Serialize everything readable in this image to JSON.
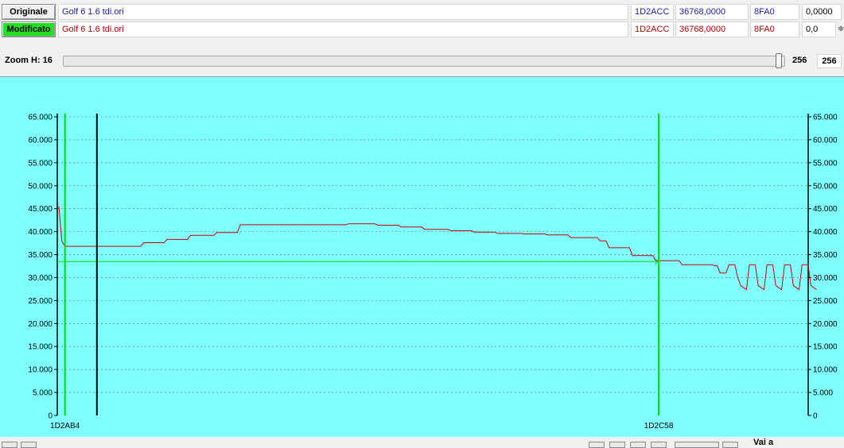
{
  "originale": {
    "button_label": "Originale",
    "filename": "Golf 6 1.6 tdi.ori",
    "address": "1D2ACC",
    "value": "36768,0000",
    "hex": "8FA0",
    "extra": "0,0000"
  },
  "modificato": {
    "button_label": "Modificato",
    "filename": "Golf 6 1.6 tdi.ori",
    "address": "1D2ACC",
    "value": "36768,0000",
    "hex": "8FA0",
    "extra": "0,0"
  },
  "zoom": {
    "label": "Zoom H: 16",
    "slider_fraction": 1.0,
    "value_label": "256",
    "box_value": "256"
  },
  "chart_data": {
    "type": "line",
    "background": "#80ffff",
    "line_color": "#cc0000",
    "marker_color": "#00dd00",
    "cursor_color": "#000000",
    "ylim": [
      0,
      65000
    ],
    "yticks": [
      "0",
      "5.000",
      "10.000",
      "15.000",
      "20.000",
      "25.000",
      "30.000",
      "35.000",
      "40.000",
      "45.000",
      "50.000",
      "55.000",
      "60.000",
      "65.000"
    ],
    "ytick_values": [
      0,
      5000,
      10000,
      15000,
      20000,
      25000,
      30000,
      35000,
      40000,
      45000,
      50000,
      55000,
      60000,
      65000
    ],
    "x_start_label": "1D2AB4",
    "x_end_label": "1D2C58",
    "grid": true,
    "x_count": 256,
    "series_values": [
      45500,
      38000,
      36800,
      36800,
      36800,
      36800,
      36800,
      36800,
      36800,
      36800,
      36800,
      36800,
      36800,
      36800,
      36800,
      36800,
      36800,
      36800,
      36800,
      36800,
      36800,
      36800,
      36800,
      36800,
      36800,
      36800,
      36800,
      36800,
      36800,
      37600,
      37600,
      37600,
      37600,
      37600,
      37600,
      37600,
      37600,
      38300,
      38300,
      38300,
      38300,
      38300,
      38300,
      38300,
      38300,
      39200,
      39200,
      39200,
      39200,
      39200,
      39200,
      39200,
      39200,
      39200,
      39800,
      39800,
      39800,
      39800,
      39800,
      39800,
      39800,
      39800,
      41500,
      41500,
      41500,
      41500,
      41500,
      41500,
      41500,
      41500,
      41500,
      41500,
      41500,
      41500,
      41500,
      41500,
      41500,
      41500,
      41500,
      41500,
      41500,
      41500,
      41500,
      41500,
      41500,
      41500,
      41500,
      41500,
      41500,
      41500,
      41500,
      41500,
      41500,
      41500,
      41500,
      41500,
      41500,
      41500,
      41500,
      41700,
      41700,
      41700,
      41700,
      41700,
      41700,
      41700,
      41700,
      41700,
      41700,
      41400,
      41400,
      41400,
      41400,
      41400,
      41400,
      41400,
      41400,
      41000,
      41000,
      41000,
      41000,
      41000,
      41000,
      41000,
      41000,
      40500,
      40500,
      40500,
      40500,
      40500,
      40500,
      40500,
      40500,
      40500,
      40200,
      40200,
      40200,
      40200,
      40200,
      40200,
      40200,
      40200,
      39900,
      39900,
      39900,
      39900,
      39900,
      39900,
      39900,
      39900,
      39600,
      39600,
      39600,
      39600,
      39600,
      39600,
      39600,
      39600,
      39600,
      39500,
      39500,
      39500,
      39500,
      39500,
      39500,
      39500,
      39500,
      39300,
      39300,
      39300,
      39300,
      39300,
      39300,
      39300,
      39300,
      38700,
      38700,
      38700,
      38700,
      38700,
      38700,
      38700,
      38700,
      38700,
      38700,
      38000,
      38000,
      38000,
      36500,
      36500,
      36500,
      36500,
      36500,
      36500,
      36500,
      36500,
      34800,
      34800,
      34800,
      34800,
      34800,
      34800,
      34800,
      34800,
      33700,
      33700,
      33700,
      33700,
      33700,
      33700,
      33700,
      33700,
      33700,
      32800,
      32800,
      32800,
      32800,
      32800,
      32800,
      32800,
      32800,
      32800,
      32800,
      32800,
      32600,
      32600,
      31000,
      31000,
      31000,
      32800,
      32800,
      32800,
      30000,
      28300,
      27800,
      27400,
      32800,
      32800,
      32800,
      28300,
      27800,
      27400,
      32800,
      32800,
      32800,
      28300,
      27800,
      27400,
      32800,
      32800,
      32800,
      28300,
      27800,
      27400,
      32800,
      32800,
      32800,
      28300,
      27800,
      27400
    ],
    "hline_value": 33500,
    "marker_left_index": 1,
    "marker_right_index": 205,
    "cursor_index": 13
  },
  "bottom": {
    "vai_label": "Vai a"
  }
}
